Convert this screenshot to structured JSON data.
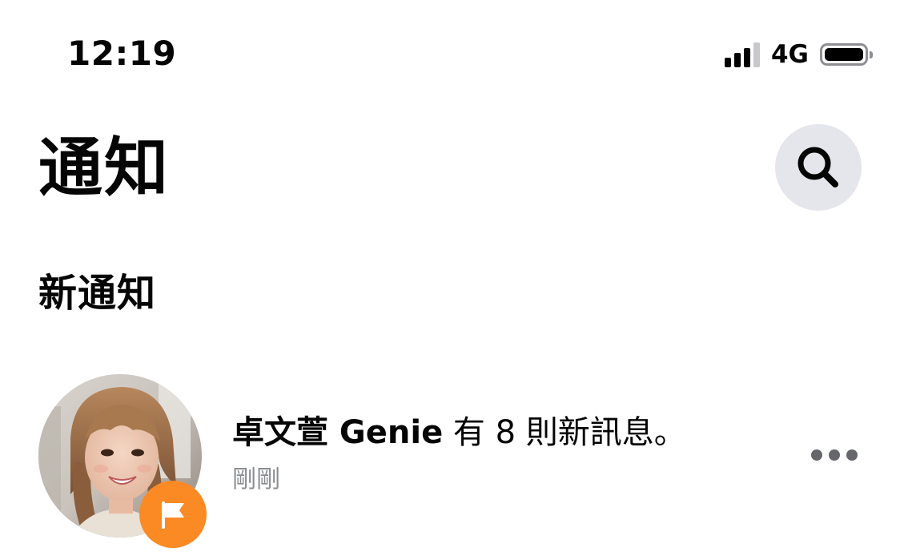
{
  "status_bar": {
    "time": "12:19",
    "network": "4G",
    "icons": [
      "cellular-signal-icon",
      "battery-icon"
    ]
  },
  "header": {
    "title": "通知",
    "search_icon": "search-icon"
  },
  "section": {
    "title": "新通知"
  },
  "notifications": [
    {
      "sender": "卓文萱 Genie",
      "message": " 有 8 則新訊息。",
      "time": "剛剛",
      "avatar_icon": "avatar-photo",
      "badge_icon": "flag-icon",
      "more_icon": "more-options-icon"
    }
  ],
  "colors": {
    "background": "#ffffff",
    "search_button_bg": "#e4e6eb",
    "badge_orange": "#fb8a24",
    "secondary_text": "#8a8d91",
    "more_dots": "#65676b"
  }
}
